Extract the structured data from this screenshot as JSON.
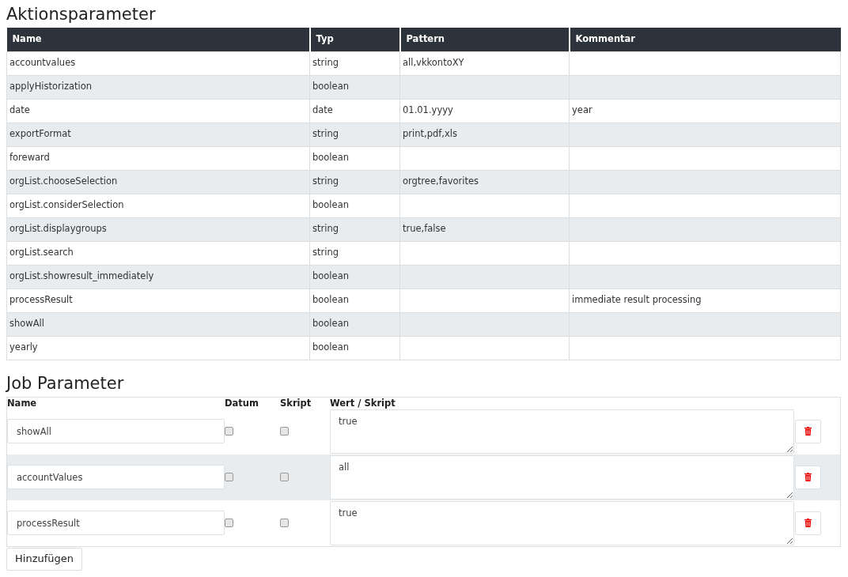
{
  "actions": {
    "title": "Aktionsparameter",
    "columns": [
      "Name",
      "Typ",
      "Pattern",
      "Kommentar"
    ],
    "rows": [
      [
        "accountvalues",
        "string",
        "all,vkkontoXY",
        ""
      ],
      [
        "applyHistorization",
        "boolean",
        "",
        ""
      ],
      [
        "date",
        "date",
        "01.01.yyyy",
        "year"
      ],
      [
        "exportFormat",
        "string",
        "print,pdf,xls",
        ""
      ],
      [
        "foreward",
        "boolean",
        "",
        ""
      ],
      [
        "orgList.chooseSelection",
        "string",
        "orgtree,favorites",
        ""
      ],
      [
        "orgList.considerSelection",
        "boolean",
        "",
        ""
      ],
      [
        "orgList.displaygroups",
        "string",
        "true,false",
        ""
      ],
      [
        "orgList.search",
        "string",
        "",
        ""
      ],
      [
        "orgList.showresult_immediately",
        "boolean",
        "",
        ""
      ],
      [
        "processResult",
        "boolean",
        "",
        "immediate result processing"
      ],
      [
        "showAll",
        "boolean",
        "",
        ""
      ],
      [
        "yearly",
        "boolean",
        "",
        ""
      ]
    ]
  },
  "job": {
    "title": "Job Parameter",
    "columns": [
      "Name",
      "Datum",
      "Skript",
      "Wert / Skript"
    ],
    "rows": [
      {
        "name": "showAll",
        "datum_checked": false,
        "skript_checked": false,
        "value": "true"
      },
      {
        "name": "accountValues",
        "datum_checked": false,
        "skript_checked": false,
        "value": "all"
      },
      {
        "name": "processResult",
        "datum_checked": false,
        "skript_checked": false,
        "value": "true"
      }
    ],
    "add_button": "Hinzufügen"
  }
}
